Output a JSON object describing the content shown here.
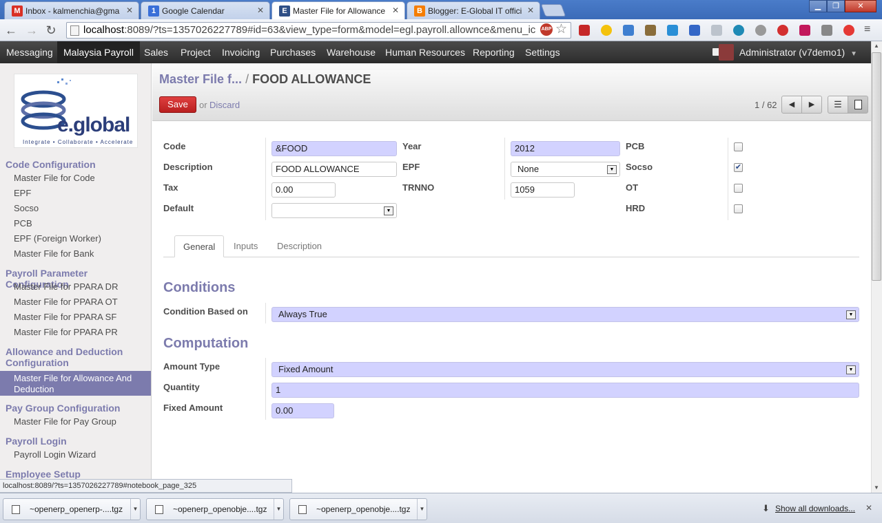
{
  "browser": {
    "tabs": [
      {
        "title": "Inbox - kalmenchia@gma",
        "favicon": "gmail-icon",
        "favicon_text": "M",
        "favicon_color": "#d93025"
      },
      {
        "title": "Google Calendar",
        "favicon": "calendar-icon",
        "favicon_text": "1",
        "favicon_color": "#3a6fd8"
      },
      {
        "title": "Master File for Allowance",
        "favicon": "openerp-icon",
        "favicon_text": "E",
        "favicon_color": "#2f4f86"
      },
      {
        "title": "Blogger: E-Global IT offici",
        "favicon": "blogger-icon",
        "favicon_text": "B",
        "favicon_color": "#f57d00"
      }
    ],
    "url_host": "localhost",
    "url_rest": ":8089/?ts=1357026227789#id=63&view_type=form&model=egl.payroll.allownce&menu_ic",
    "status_url": "localhost:8089/?ts=1357026227789#notebook_page_325"
  },
  "topmenu": {
    "items": [
      "Messaging",
      "Malaysia Payroll",
      "Sales",
      "Project",
      "Invoicing",
      "Purchases",
      "Warehouse",
      "Human Resources",
      "Reporting",
      "Settings"
    ],
    "active": "Malaysia Payroll",
    "user": "Administrator (v7demo1)"
  },
  "logo": {
    "brand": "e.global",
    "tagline": "Integrate • Collaborate • Accelerate"
  },
  "sidebar": {
    "sections": [
      {
        "title": "Code Configuration",
        "items": [
          "Master File for Code",
          "EPF",
          "Socso",
          "PCB",
          "EPF (Foreign Worker)",
          "Master File for Bank"
        ]
      },
      {
        "title": "Payroll Parameter Configuration",
        "items": [
          "Master File for PPARA DR",
          "Master File for PPARA OT",
          "Master File for PPARA SF",
          "Master File for PPARA PR"
        ]
      },
      {
        "title_line1": "Allowance and Deduction",
        "title_line2": "Configuration",
        "items": [
          "Master File for Allowance And",
          "Deduction"
        ]
      },
      {
        "title": "Pay Group Configuration",
        "items": [
          "Master File for Pay Group"
        ]
      },
      {
        "title": "Payroll Login",
        "items": [
          "Payroll Login Wizard"
        ]
      },
      {
        "title": "Employee Setup",
        "items": []
      }
    ]
  },
  "header": {
    "breadcrumb_prev": "Master File f...",
    "breadcrumb_sep": "/",
    "breadcrumb_current": "FOOD ALLOWANCE",
    "save_label": "Save",
    "or_label": "or",
    "discard_label": "Discard",
    "pager": "1 / 62"
  },
  "form": {
    "code_label": "Code",
    "code_value": "&FOOD",
    "description_label": "Description",
    "description_value": "FOOD ALLOWANCE",
    "tax_label": "Tax",
    "tax_value": "0.00",
    "default_label": "Default",
    "default_value": "",
    "year_label": "Year",
    "year_value": "2012",
    "epf_label": "EPF",
    "epf_value": "None",
    "trnno_label": "TRNNO",
    "trnno_value": "1059",
    "pcb_label": "PCB",
    "pcb_checked": false,
    "socso_label": "Socso",
    "socso_checked": true,
    "ot_label": "OT",
    "ot_checked": false,
    "hrd_label": "HRD",
    "hrd_checked": false
  },
  "notebook": {
    "tabs": [
      "General",
      "Inputs",
      "Description"
    ],
    "active": "General"
  },
  "conditions": {
    "heading": "Conditions",
    "condition_label": "Condition Based on",
    "condition_value": "Always True"
  },
  "computation": {
    "heading": "Computation",
    "amount_type_label": "Amount Type",
    "amount_type_value": "Fixed Amount",
    "quantity_label": "Quantity",
    "quantity_value": "1",
    "fixed_amount_label": "Fixed Amount",
    "fixed_amount_value": "0.00"
  },
  "downloads": {
    "items": [
      "~openerp_openerp-....tgz",
      "~openerp_openobje....tgz",
      "~openerp_openobje....tgz"
    ],
    "show_all": "Show all downloads..."
  },
  "colors": {
    "accent": "#7c7bad",
    "required_bg": "#d2d2ff",
    "save_red": "#c62828",
    "menu_bg": "#333333"
  }
}
